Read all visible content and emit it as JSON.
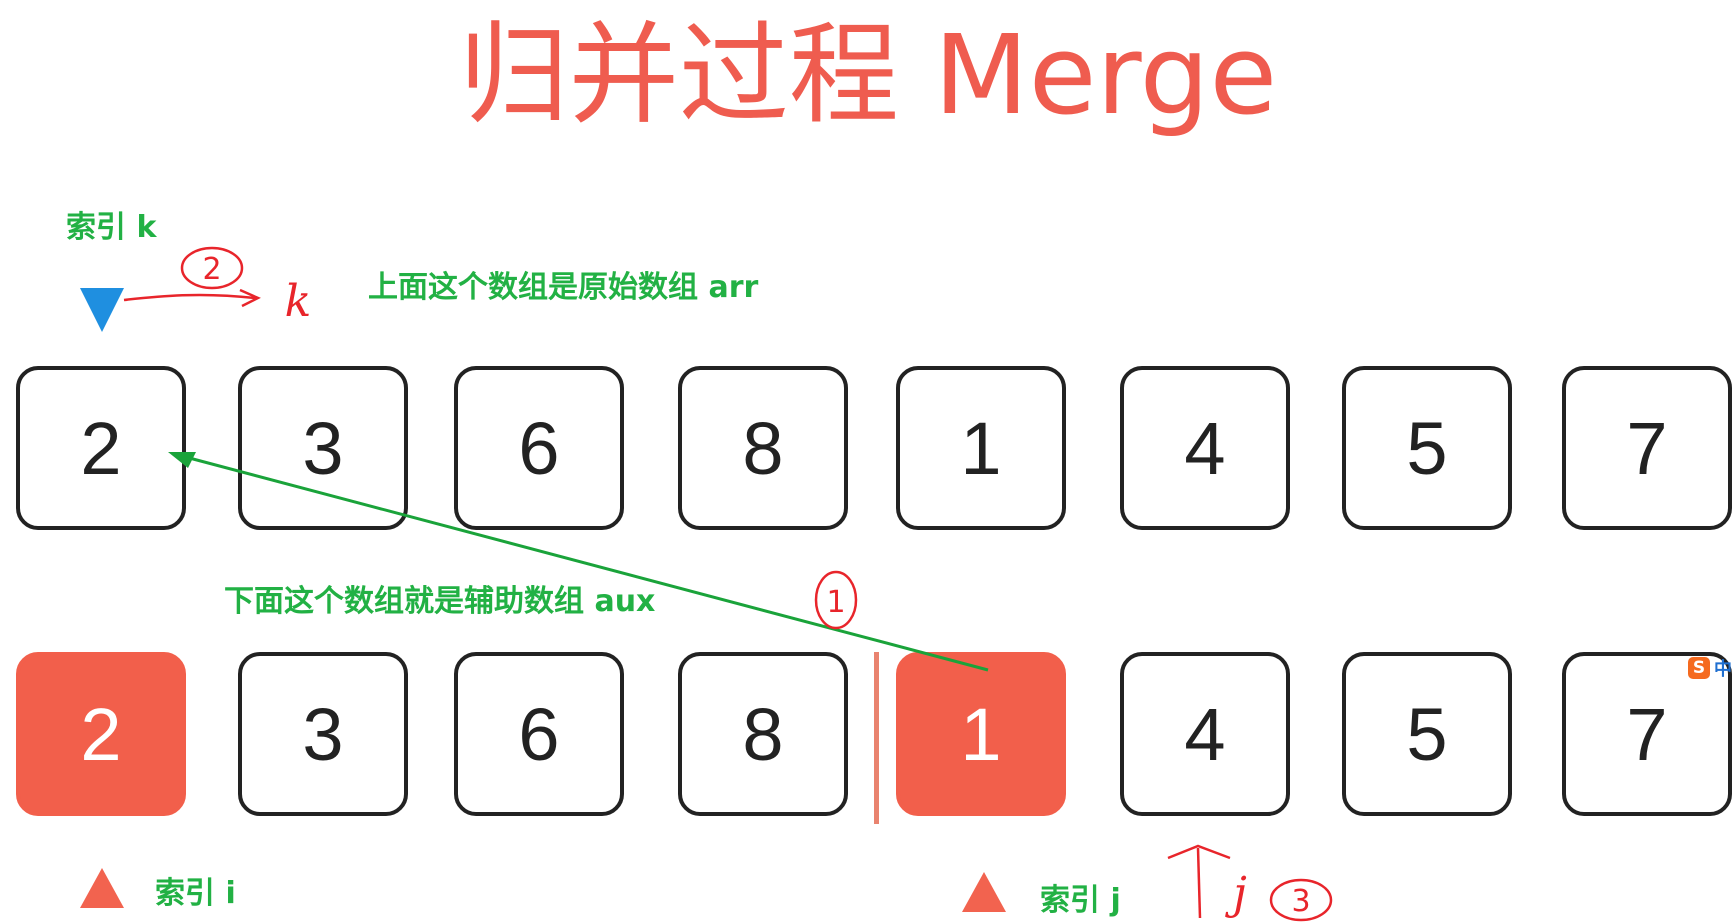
{
  "title": "归并过程 Merge",
  "labels": {
    "index_k": "索引 k",
    "arr_desc": "上面这个数组是原始数组 arr",
    "aux_desc": "下面这个数组就是辅助数组 aux",
    "index_i": "索引 i",
    "index_j": "索引 j"
  },
  "arr": [
    "2",
    "3",
    "6",
    "8",
    "1",
    "4",
    "5",
    "7"
  ],
  "aux": [
    "2",
    "3",
    "6",
    "8",
    "1",
    "4",
    "5",
    "7"
  ],
  "aux_highlighted": [
    0,
    4
  ],
  "colors": {
    "title": "#ef5c4f",
    "label": "#22b144",
    "highlight": "#f25f4b",
    "pointer_k": "#1f8fe0",
    "pointer_ij": "#f2634f",
    "annotation": "#e8252b",
    "arrow": "#1aa33a"
  },
  "annotations": [
    "1",
    "2",
    "k",
    "3",
    "j"
  ],
  "ime": {
    "logo": "S",
    "mode": "中"
  }
}
